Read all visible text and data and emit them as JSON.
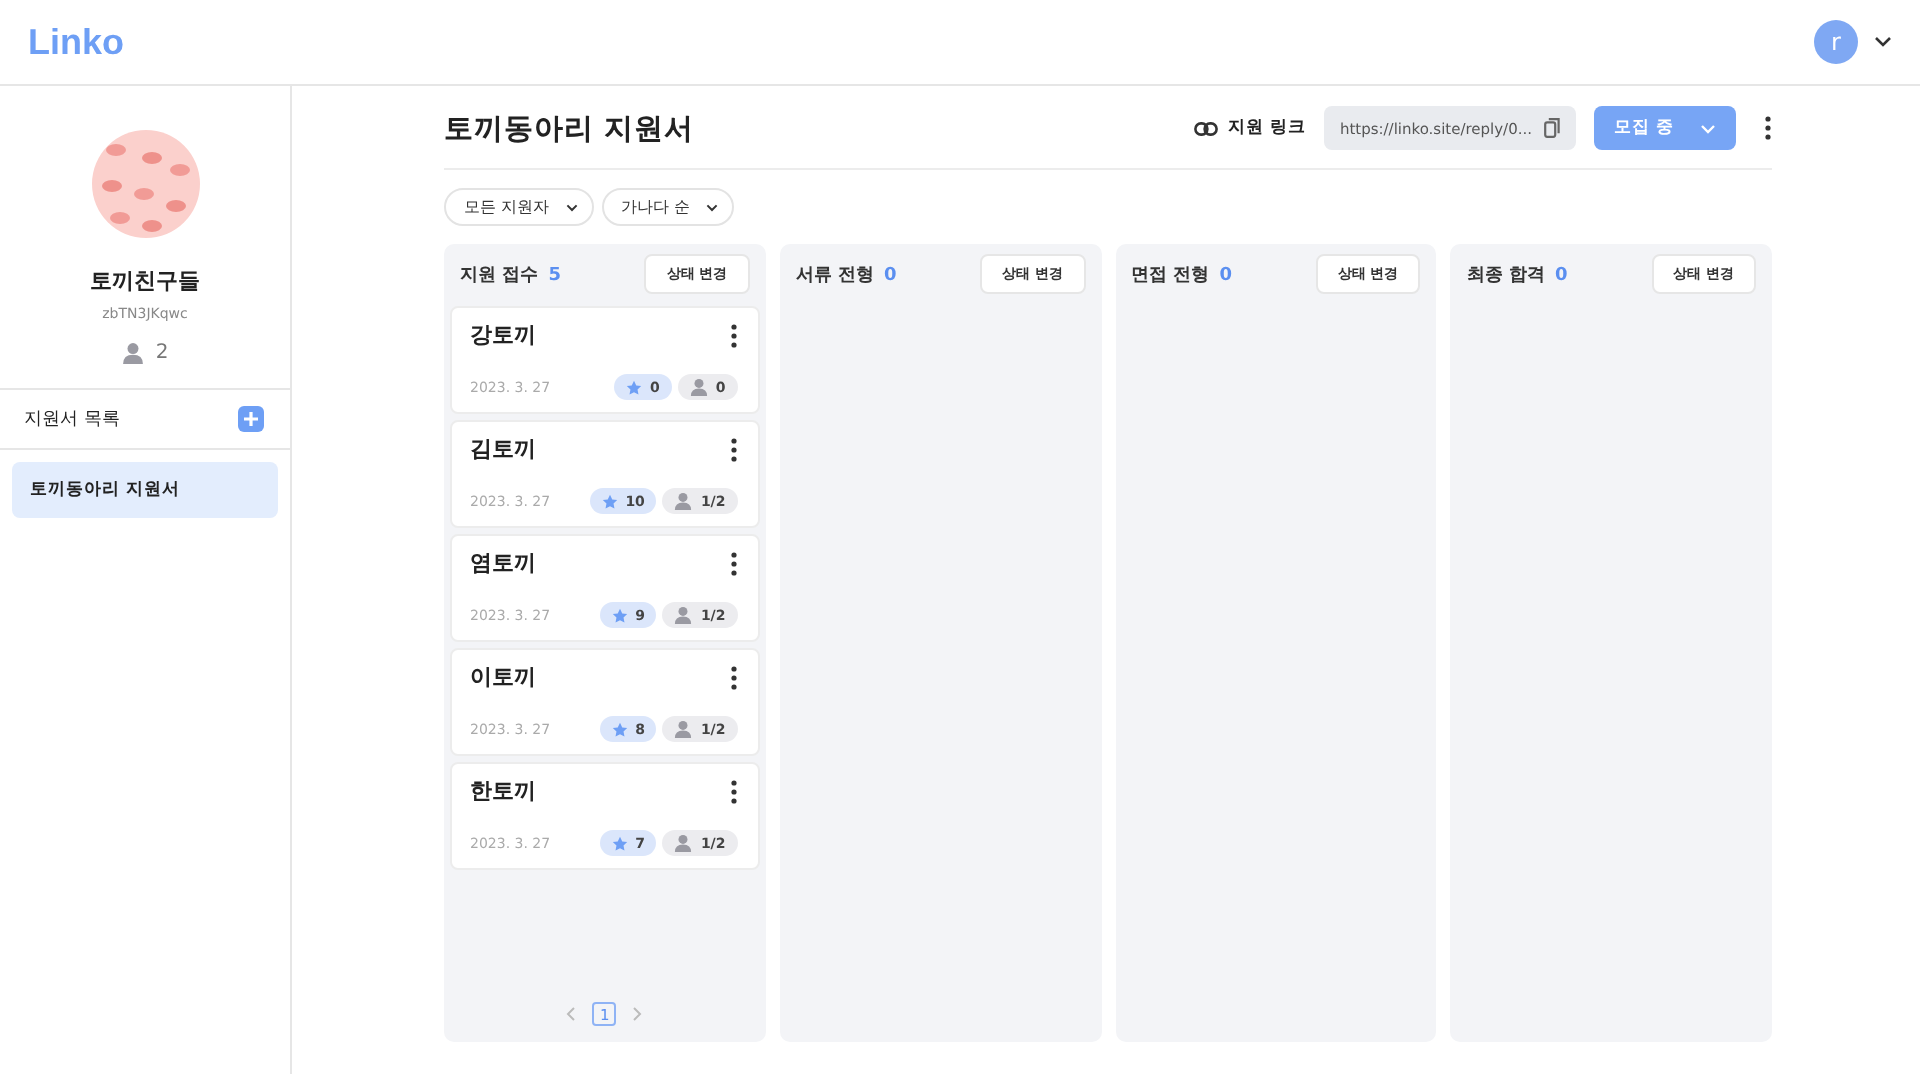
{
  "header": {
    "logo": "Linko",
    "user_initial": "r"
  },
  "sidebar": {
    "club_name": "토끼친구들",
    "club_code": "zbTN3JKqwc",
    "member_count": "2",
    "list_title": "지원서 목록",
    "forms": [
      {
        "label": "토끼동아리 지원서",
        "selected": true
      }
    ]
  },
  "page": {
    "title": "토끼동아리 지원서",
    "link_label": "지원 링크",
    "link_url": "https://linko.site/reply/0...",
    "status": "모집 중"
  },
  "filters": [
    {
      "label": "모든 지원자"
    },
    {
      "label": "가나다 순"
    }
  ],
  "columns": [
    {
      "title": "지원 접수",
      "count": "5",
      "action": "상태 변경",
      "cards": [
        {
          "name": "강토끼",
          "date": "2023. 3. 27",
          "stars": "0",
          "reviews": "0"
        },
        {
          "name": "김토끼",
          "date": "2023. 3. 27",
          "stars": "10",
          "reviews": "1/2"
        },
        {
          "name": "염토끼",
          "date": "2023. 3. 27",
          "stars": "9",
          "reviews": "1/2"
        },
        {
          "name": "이토끼",
          "date": "2023. 3. 27",
          "stars": "8",
          "reviews": "1/2"
        },
        {
          "name": "한토끼",
          "date": "2023. 3. 27",
          "stars": "7",
          "reviews": "1/2"
        }
      ],
      "pages": [
        {
          "label": "1",
          "selected": true
        }
      ]
    },
    {
      "title": "서류 전형",
      "count": "0",
      "action": "상태 변경"
    },
    {
      "title": "면접 전형",
      "count": "0",
      "action": "상태 변경"
    },
    {
      "title": "최종 합격",
      "count": "0",
      "action": "상태 변경"
    }
  ]
}
